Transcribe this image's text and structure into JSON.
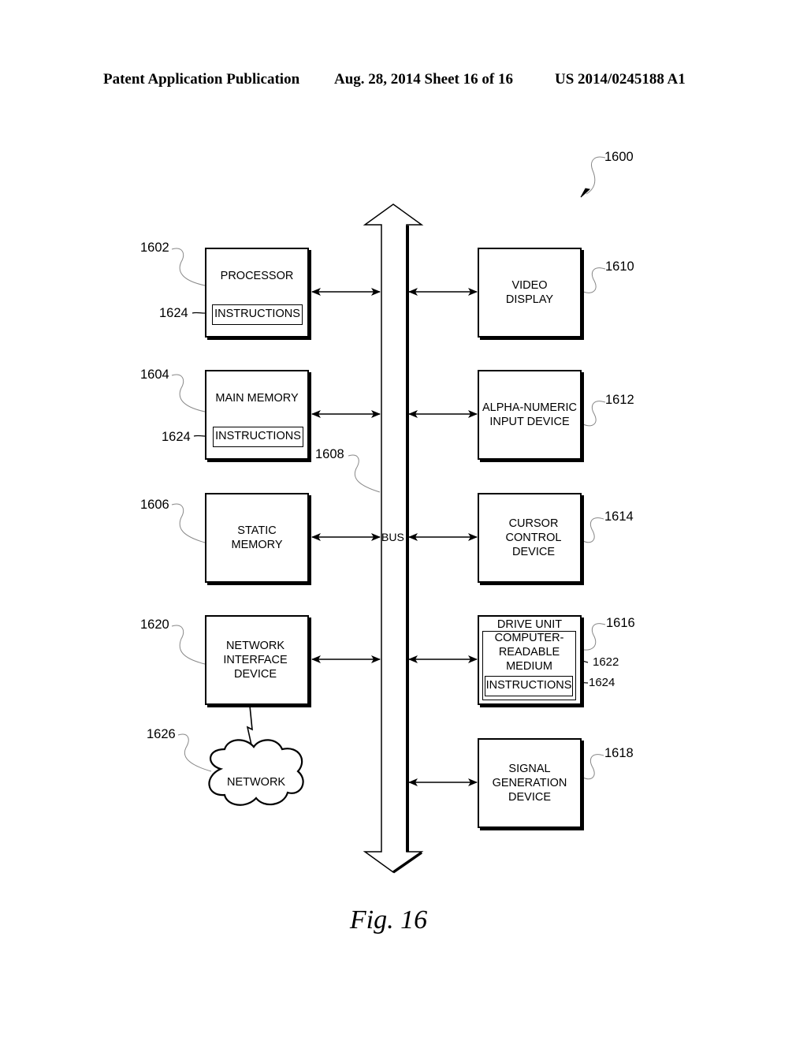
{
  "header": {
    "left": "Patent Application Publication",
    "middle": "Aug. 28, 2014  Sheet 16 of 16",
    "right": "US 2014/0245188 A1"
  },
  "figure": {
    "ref": "1600",
    "caption": "Fig. 16",
    "bus": {
      "label": "BUS",
      "ref": "1608"
    },
    "left_blocks": [
      {
        "ref": "1602",
        "label": "PROCESSOR",
        "inner": "INSTRUCTIONS",
        "inner_ref": "1624"
      },
      {
        "ref": "1604",
        "label": "MAIN MEMORY",
        "inner": "INSTRUCTIONS",
        "inner_ref": "1624"
      },
      {
        "ref": "1606",
        "label": "STATIC\nMEMORY"
      },
      {
        "ref": "1620",
        "label": "NETWORK\nINTERFACE\nDEVICE"
      }
    ],
    "right_blocks": [
      {
        "ref": "1610",
        "label": "VIDEO\nDISPLAY"
      },
      {
        "ref": "1612",
        "label": "ALPHA-NUMERIC\nINPUT DEVICE"
      },
      {
        "ref": "1614",
        "label": "CURSOR\nCONTROL\nDEVICE"
      },
      {
        "ref": "1616",
        "label": "DRIVE UNIT",
        "medium": "COMPUTER-\nREADABLE\nMEDIUM",
        "medium_ref": "1622",
        "inner": "INSTRUCTIONS",
        "inner_ref": "1624"
      },
      {
        "ref": "1618",
        "label": "SIGNAL\nGENERATION\nDEVICE"
      }
    ],
    "network": {
      "label": "NETWORK",
      "ref": "1626"
    }
  }
}
